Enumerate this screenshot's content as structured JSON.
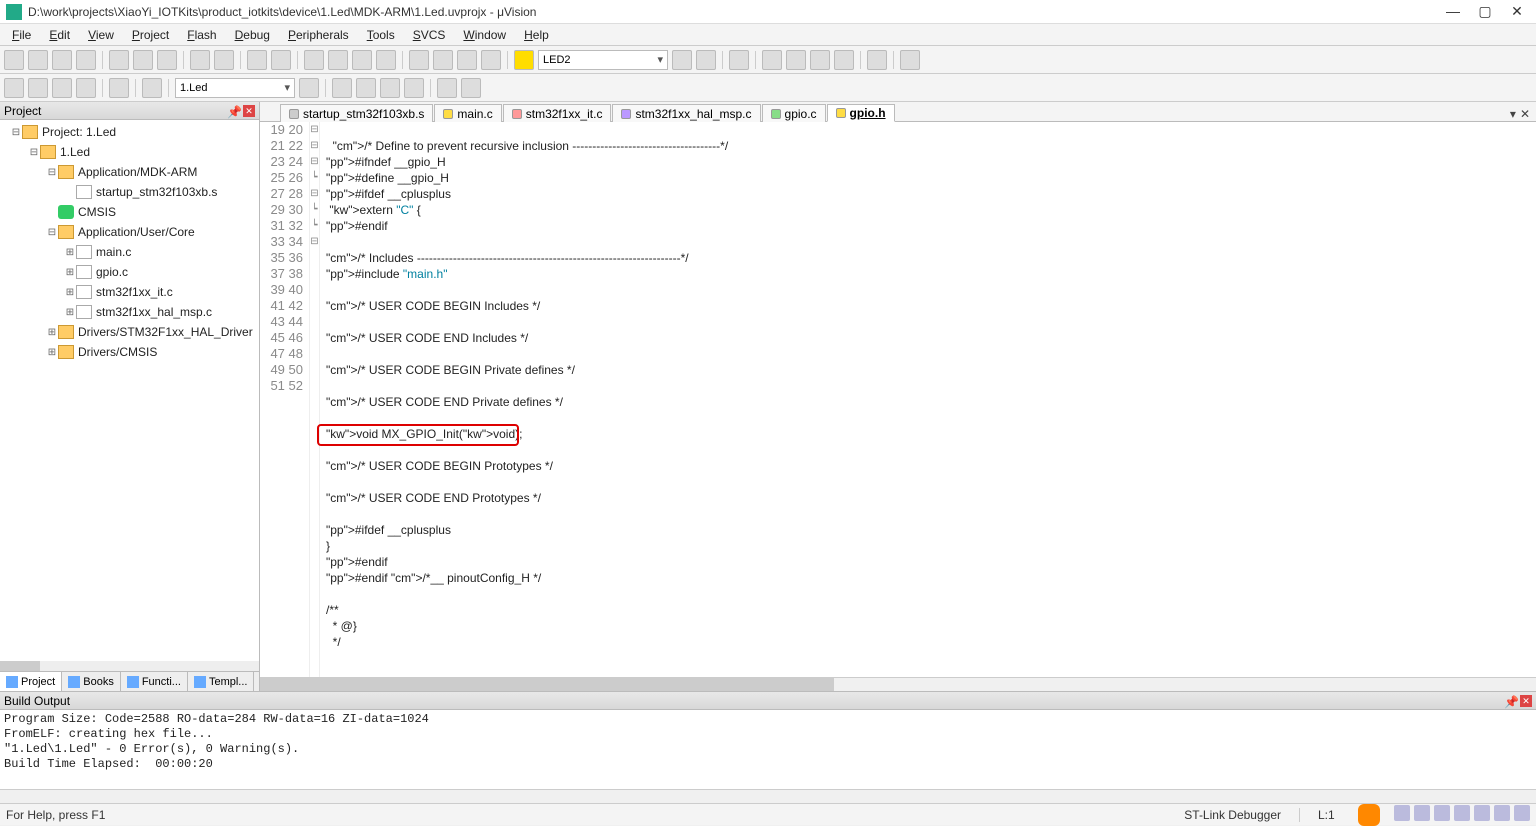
{
  "title": "D:\\work\\projects\\XiaoYi_IOTKits\\product_iotkits\\device\\1.Led\\MDK-ARM\\1.Led.uvprojx - μVision",
  "menu": [
    "File",
    "Edit",
    "View",
    "Project",
    "Flash",
    "Debug",
    "Peripherals",
    "Tools",
    "SVCS",
    "Window",
    "Help"
  ],
  "toolbar1": {
    "combo": "LED2"
  },
  "toolbar2": {
    "combo": "1.Led"
  },
  "projectPanel": {
    "title": "Project",
    "tree": [
      {
        "indent": 0,
        "exp": "⊟",
        "icon": "folder",
        "label": "Project: 1.Led"
      },
      {
        "indent": 1,
        "exp": "⊟",
        "icon": "folder",
        "label": "1.Led"
      },
      {
        "indent": 2,
        "exp": "⊟",
        "icon": "folder",
        "label": "Application/MDK-ARM"
      },
      {
        "indent": 3,
        "exp": "",
        "icon": "file",
        "label": "startup_stm32f103xb.s"
      },
      {
        "indent": 2,
        "exp": "",
        "icon": "gem",
        "label": "CMSIS"
      },
      {
        "indent": 2,
        "exp": "⊟",
        "icon": "folder",
        "label": "Application/User/Core"
      },
      {
        "indent": 3,
        "exp": "⊞",
        "icon": "file",
        "label": "main.c"
      },
      {
        "indent": 3,
        "exp": "⊞",
        "icon": "file",
        "label": "gpio.c"
      },
      {
        "indent": 3,
        "exp": "⊞",
        "icon": "file",
        "label": "stm32f1xx_it.c"
      },
      {
        "indent": 3,
        "exp": "⊞",
        "icon": "file",
        "label": "stm32f1xx_hal_msp.c"
      },
      {
        "indent": 2,
        "exp": "⊞",
        "icon": "folder",
        "label": "Drivers/STM32F1xx_HAL_Driver"
      },
      {
        "indent": 2,
        "exp": "⊞",
        "icon": "folder",
        "label": "Drivers/CMSIS"
      }
    ],
    "tabs": [
      "Project",
      "Books",
      "Functi...",
      "Templ..."
    ]
  },
  "fileTabs": [
    {
      "label": "startup_stm32f103xb.s",
      "color": "grey"
    },
    {
      "label": "main.c",
      "color": "yellow"
    },
    {
      "label": "stm32f1xx_it.c",
      "color": "pink"
    },
    {
      "label": "stm32f1xx_hal_msp.c",
      "color": "purple"
    },
    {
      "label": "gpio.c",
      "color": "green"
    },
    {
      "label": "gpio.h",
      "color": "yellow",
      "active": true
    }
  ],
  "code": {
    "startLine": 19,
    "lines": [
      "",
      "  /* Define to prevent recursive inclusion -------------------------------------*/",
      "#ifndef __gpio_H",
      "#define __gpio_H",
      "#ifdef __cplusplus",
      " extern \"C\" {",
      "#endif",
      "",
      "/* Includes ------------------------------------------------------------------*/",
      "#include \"main.h\"",
      "",
      "/* USER CODE BEGIN Includes */",
      "",
      "/* USER CODE END Includes */",
      "",
      "/* USER CODE BEGIN Private defines */",
      "",
      "/* USER CODE END Private defines */",
      "",
      "void MX_GPIO_Init(void);",
      "",
      "/* USER CODE BEGIN Prototypes */",
      "",
      "/* USER CODE END Prototypes */",
      "",
      "#ifdef __cplusplus",
      "}",
      "#endif",
      "#endif /*__ pinoutConfig_H */",
      "",
      "/**",
      "  * @}",
      "  */",
      ""
    ],
    "fold": [
      "",
      "",
      "⊟",
      "",
      "⊟",
      "⊟",
      "",
      "┕",
      "",
      "",
      "",
      "",
      "",
      "",
      "",
      "",
      "",
      "",
      "",
      "",
      "",
      "",
      "",
      "",
      "",
      "",
      "⊟",
      "┕",
      "┕",
      "",
      "",
      "⊟",
      "",
      "",
      ""
    ]
  },
  "buildOutput": {
    "title": "Build Output",
    "text": "Program Size: Code=2588 RO-data=284 RW-data=16 ZI-data=1024\nFromELF: creating hex file...\n\"1.Led\\1.Led\" - 0 Error(s), 0 Warning(s).\nBuild Time Elapsed:  00:00:20"
  },
  "statusbar": {
    "help": "For Help, press F1",
    "debugger": "ST-Link Debugger",
    "line": "L:1"
  }
}
